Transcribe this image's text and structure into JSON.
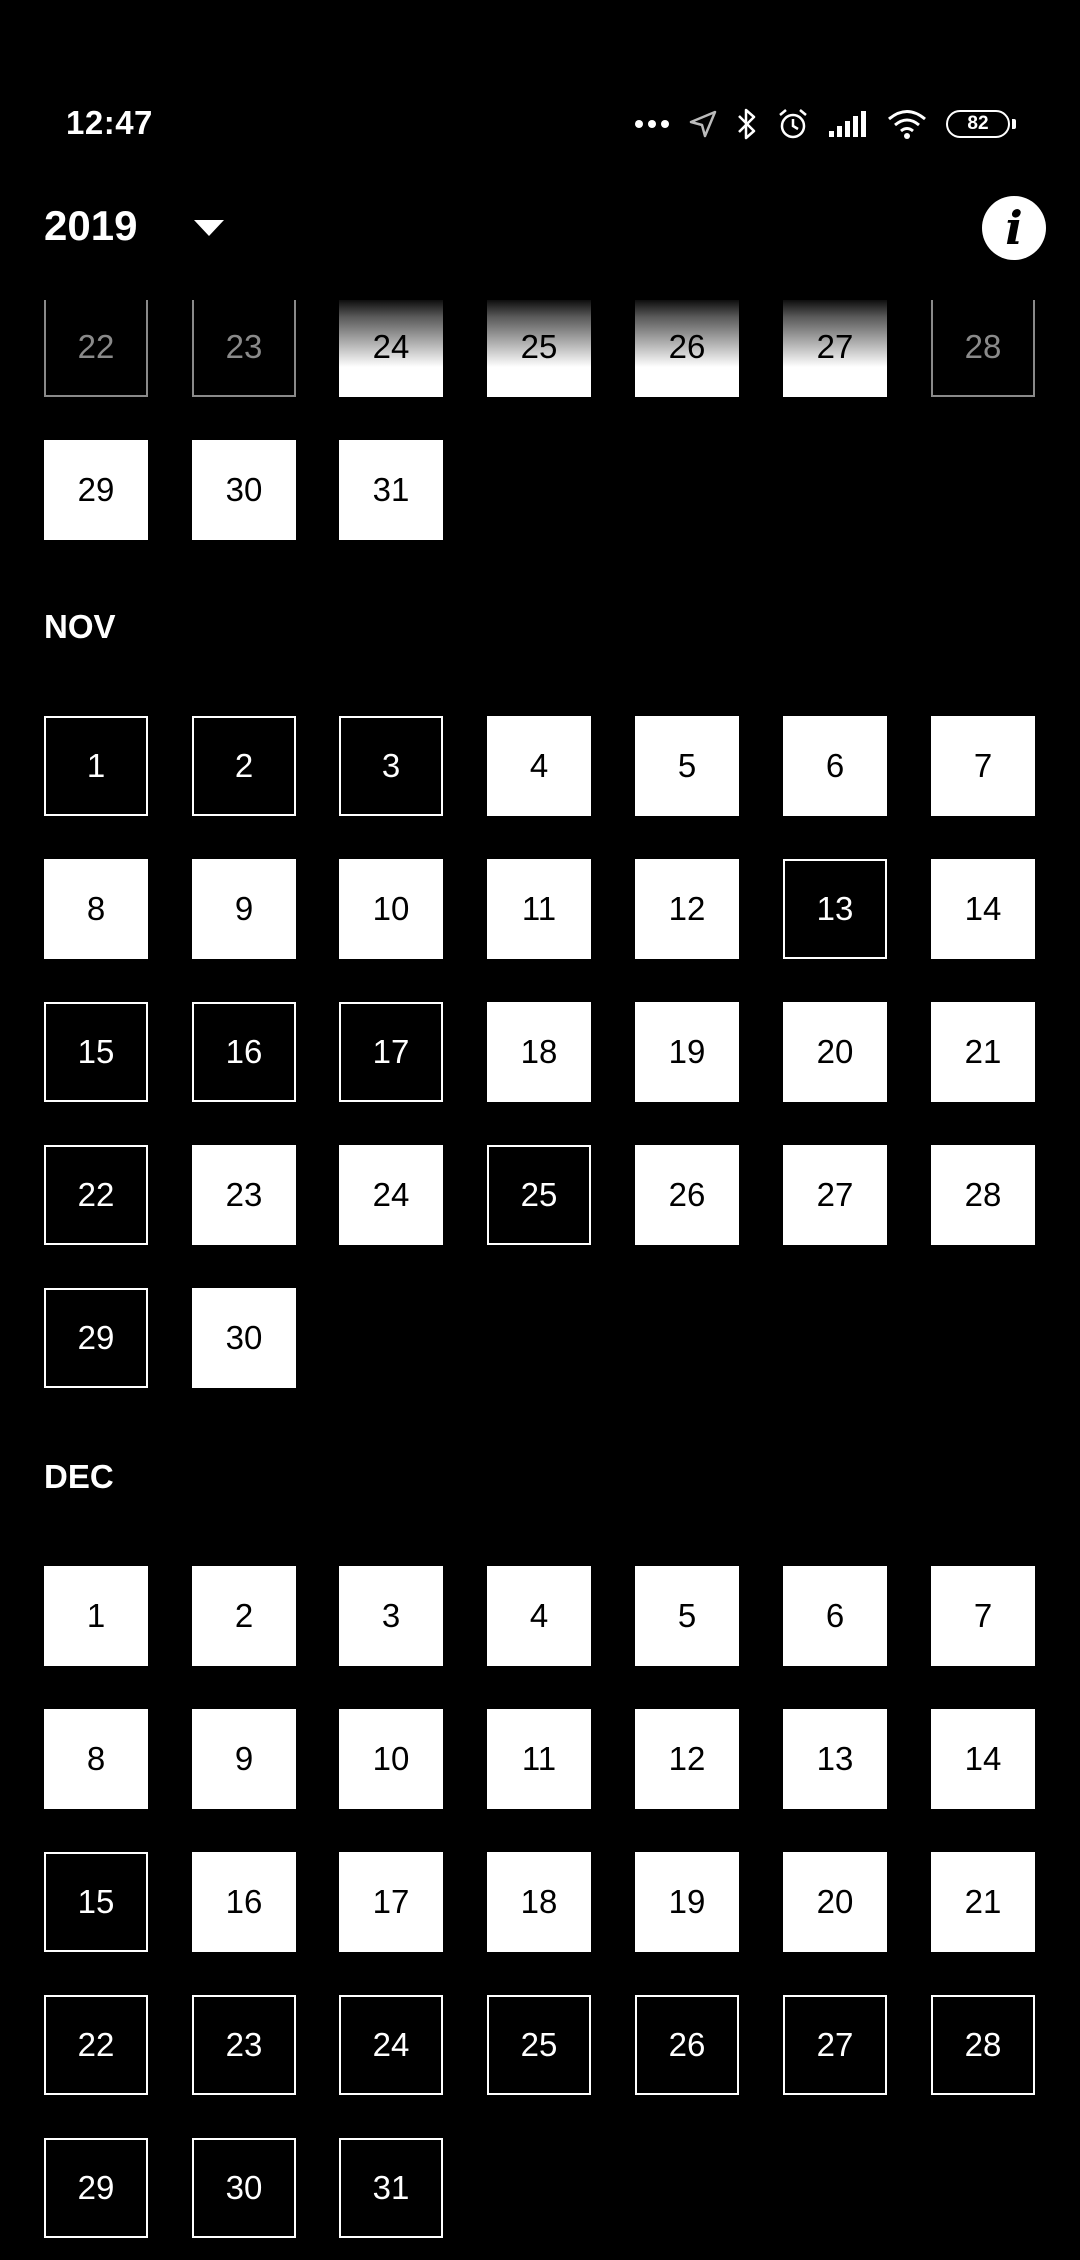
{
  "status_bar": {
    "time": "12:47",
    "battery": "82",
    "icons": [
      "more-dots-icon",
      "location-arrow-icon",
      "bluetooth-icon",
      "alarm-icon",
      "signal-icon",
      "wifi-icon",
      "battery-icon"
    ]
  },
  "header": {
    "year": "2019",
    "dropdown_icon": "caret-down-icon",
    "info_icon": "info-icon",
    "info_label": "i"
  },
  "months": [
    {
      "label": "",
      "days": [
        {
          "n": "22",
          "s": "outlined-faded"
        },
        {
          "n": "23",
          "s": "outlined-faded"
        },
        {
          "n": "24",
          "s": "filled-faded"
        },
        {
          "n": "25",
          "s": "filled-faded"
        },
        {
          "n": "26",
          "s": "filled-faded"
        },
        {
          "n": "27",
          "s": "filled-faded"
        },
        {
          "n": "28",
          "s": "outlined-faded"
        },
        {
          "n": "29",
          "s": "filled"
        },
        {
          "n": "30",
          "s": "filled"
        },
        {
          "n": "31",
          "s": "filled"
        }
      ]
    },
    {
      "label": "NOV",
      "days": [
        {
          "n": "1",
          "s": "outlined"
        },
        {
          "n": "2",
          "s": "outlined"
        },
        {
          "n": "3",
          "s": "outlined"
        },
        {
          "n": "4",
          "s": "filled"
        },
        {
          "n": "5",
          "s": "filled"
        },
        {
          "n": "6",
          "s": "filled"
        },
        {
          "n": "7",
          "s": "filled"
        },
        {
          "n": "8",
          "s": "filled"
        },
        {
          "n": "9",
          "s": "filled"
        },
        {
          "n": "10",
          "s": "filled"
        },
        {
          "n": "11",
          "s": "filled"
        },
        {
          "n": "12",
          "s": "filled"
        },
        {
          "n": "13",
          "s": "outlined"
        },
        {
          "n": "14",
          "s": "filled"
        },
        {
          "n": "15",
          "s": "outlined"
        },
        {
          "n": "16",
          "s": "outlined"
        },
        {
          "n": "17",
          "s": "outlined"
        },
        {
          "n": "18",
          "s": "filled"
        },
        {
          "n": "19",
          "s": "filled"
        },
        {
          "n": "20",
          "s": "filled"
        },
        {
          "n": "21",
          "s": "filled"
        },
        {
          "n": "22",
          "s": "outlined"
        },
        {
          "n": "23",
          "s": "filled"
        },
        {
          "n": "24",
          "s": "filled"
        },
        {
          "n": "25",
          "s": "outlined"
        },
        {
          "n": "26",
          "s": "filled"
        },
        {
          "n": "27",
          "s": "filled"
        },
        {
          "n": "28",
          "s": "filled"
        },
        {
          "n": "29",
          "s": "outlined"
        },
        {
          "n": "30",
          "s": "filled"
        }
      ]
    },
    {
      "label": "DEC",
      "days": [
        {
          "n": "1",
          "s": "filled"
        },
        {
          "n": "2",
          "s": "filled"
        },
        {
          "n": "3",
          "s": "filled"
        },
        {
          "n": "4",
          "s": "filled"
        },
        {
          "n": "5",
          "s": "filled"
        },
        {
          "n": "6",
          "s": "filled"
        },
        {
          "n": "7",
          "s": "filled"
        },
        {
          "n": "8",
          "s": "filled"
        },
        {
          "n": "9",
          "s": "filled"
        },
        {
          "n": "10",
          "s": "filled"
        },
        {
          "n": "11",
          "s": "filled"
        },
        {
          "n": "12",
          "s": "filled"
        },
        {
          "n": "13",
          "s": "filled"
        },
        {
          "n": "14",
          "s": "filled"
        },
        {
          "n": "15",
          "s": "outlined"
        },
        {
          "n": "16",
          "s": "filled"
        },
        {
          "n": "17",
          "s": "filled"
        },
        {
          "n": "18",
          "s": "filled"
        },
        {
          "n": "19",
          "s": "filled"
        },
        {
          "n": "20",
          "s": "filled"
        },
        {
          "n": "21",
          "s": "filled"
        },
        {
          "n": "22",
          "s": "outlined"
        },
        {
          "n": "23",
          "s": "outlined"
        },
        {
          "n": "24",
          "s": "outlined"
        },
        {
          "n": "25",
          "s": "outlined"
        },
        {
          "n": "26",
          "s": "outlined"
        },
        {
          "n": "27",
          "s": "outlined"
        },
        {
          "n": "28",
          "s": "outlined"
        },
        {
          "n": "29",
          "s": "outlined"
        },
        {
          "n": "30",
          "s": "outlined"
        },
        {
          "n": "31",
          "s": "outlined"
        }
      ]
    }
  ]
}
